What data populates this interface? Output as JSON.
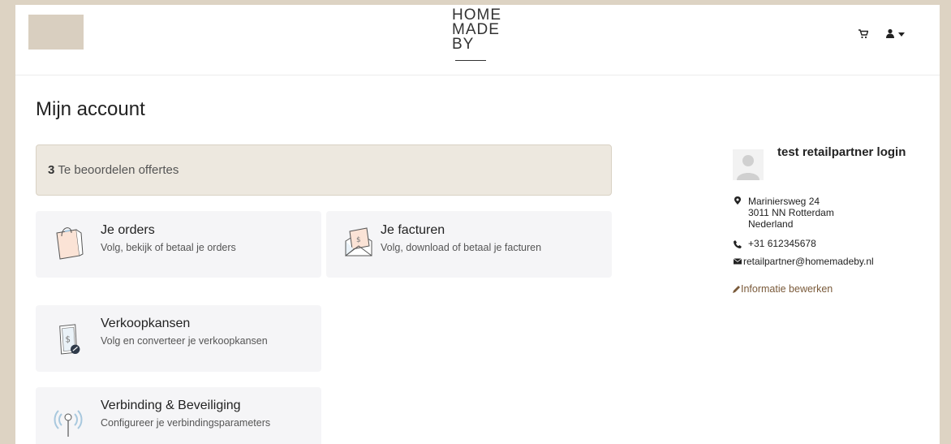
{
  "brand": {
    "line1": "HOME",
    "line2": "MADE",
    "line3": "BY"
  },
  "header": {
    "cart_icon": "cart-icon",
    "user_icon": "user-icon"
  },
  "page": {
    "title": "Mijn account"
  },
  "alert": {
    "count": "3",
    "text": "Te beoordelen offertes"
  },
  "cards": [
    {
      "title": "Je orders",
      "subtitle": "Volg, bekijk of betaal je orders",
      "icon": "shopping-bag-icon"
    },
    {
      "title": "Je facturen",
      "subtitle": "Volg, download of betaal je facturen",
      "icon": "invoice-envelope-icon"
    },
    {
      "title": "Verkoopkansen",
      "subtitle": "Volg en converteer je verkoopkansen",
      "icon": "sales-opportunity-icon"
    },
    {
      "title": "Verbinding & Beveiliging",
      "subtitle": "Configureer je verbindingsparameters",
      "icon": "antenna-icon"
    }
  ],
  "profile": {
    "name": "test retailpartner login",
    "address_line1": "Mariniersweg 24",
    "address_line2": "3011 NN Rotterdam",
    "address_line3": "Nederland",
    "phone": "+31 612345678",
    "email": "retailpartner@homemadeby.nl",
    "edit_label": "Informatie bewerken"
  },
  "colors": {
    "background": "#ddd3c3",
    "alert_bg": "#ede8df",
    "card_bg": "#f5f5f7",
    "edit_link": "#7a5a3a"
  }
}
